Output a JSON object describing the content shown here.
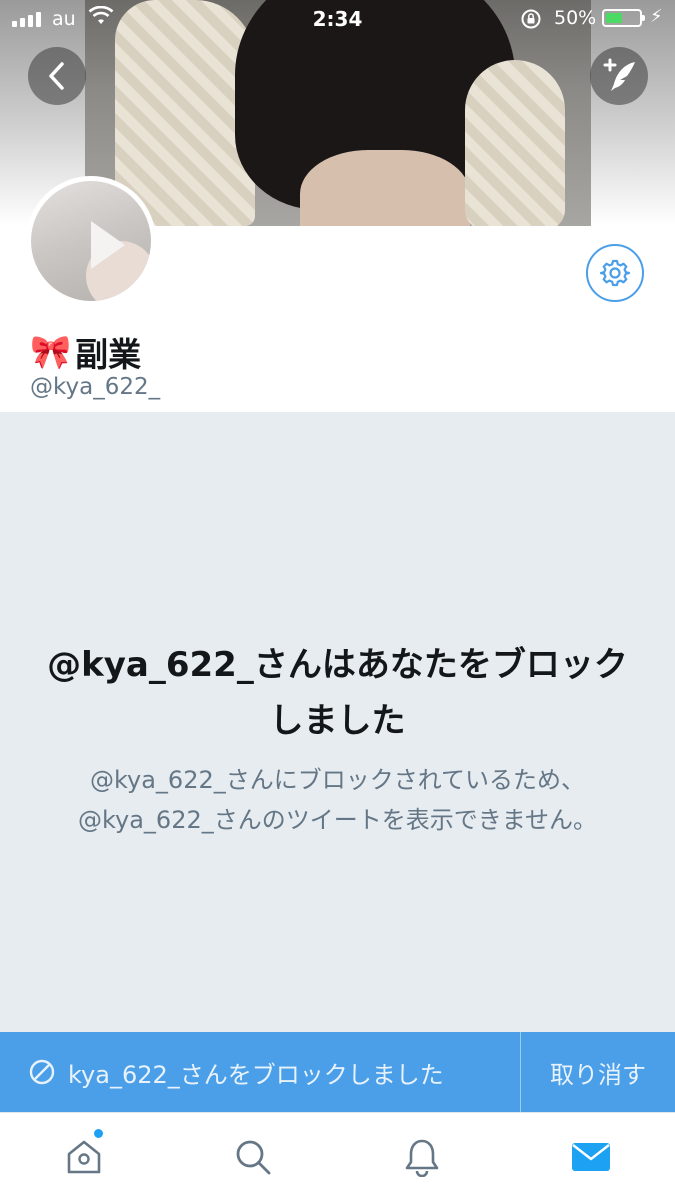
{
  "status_bar": {
    "carrier": "au",
    "time": "2:34",
    "battery_percent": "50%",
    "battery_level": 0.5,
    "colors": {
      "battery_fill": "#4cd964"
    }
  },
  "header": {
    "back_icon": "chevron-left-icon",
    "compose_icon": "compose-tweet-icon"
  },
  "profile": {
    "display_name_emoji": "🎀",
    "display_name": "副業",
    "handle": "@kya_622_",
    "settings_icon": "gear-icon"
  },
  "blocked": {
    "title": "@kya_622_さんはあなたをブロックしました",
    "description": "@kya_622_さんにブロックされているため、@kya_622_さんのツイートを表示できません。"
  },
  "block_bar": {
    "icon": "block-icon",
    "message": "kya_622_さんをブロックしました",
    "undo_label": "取り消す",
    "color": "#4a9fe8"
  },
  "tab_bar": {
    "tabs": [
      {
        "icon": "home-icon",
        "has_notification_dot": true
      },
      {
        "icon": "search-icon"
      },
      {
        "icon": "notifications-bell-icon"
      },
      {
        "icon": "messages-envelope-icon",
        "active": true
      }
    ],
    "accent": "#1da1f2"
  }
}
